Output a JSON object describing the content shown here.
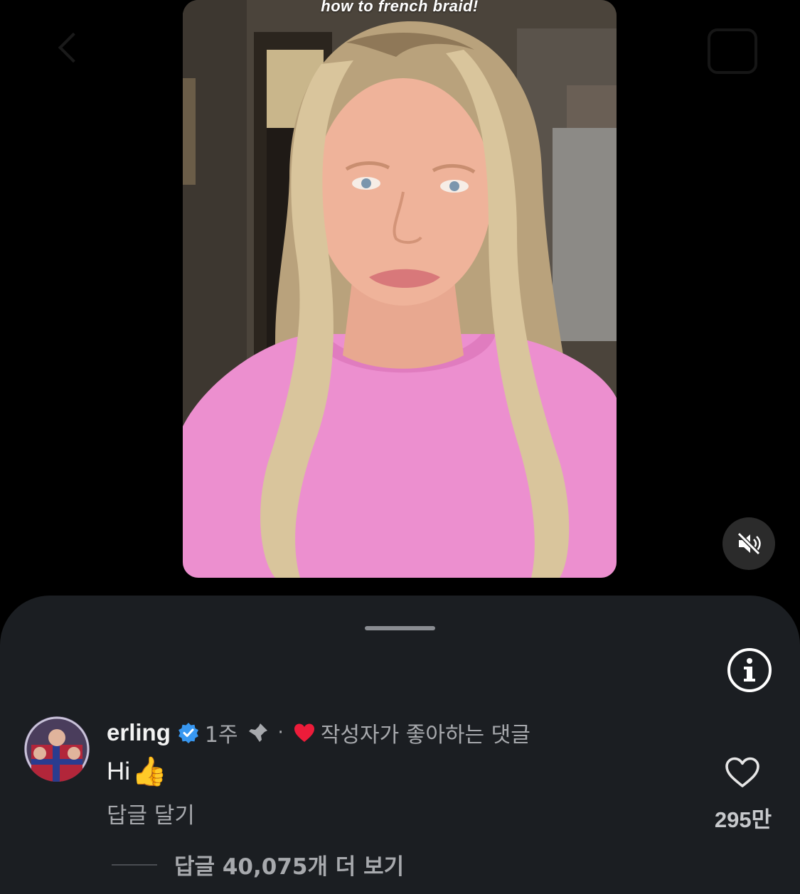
{
  "video": {
    "caption": "how to french braid!",
    "mute_icon": "speaker-muted-icon"
  },
  "sheet": {
    "info_icon": "info-icon"
  },
  "comment": {
    "username": "erling",
    "verified_icon": "verified-badge-icon",
    "time": "1주",
    "pin_icon": "pin-icon",
    "separator": "·",
    "liked_by_author_icon": "heart-icon",
    "liked_by_author_text": "작성자가 좋아하는 댓글",
    "text": "Hi",
    "emoji": "👍",
    "reply_label": "답글 달기",
    "like_icon": "heart-outline-icon",
    "like_count": "295만",
    "view_replies_label": "답글 40,075개 더 보기"
  },
  "colors": {
    "background": "#000000",
    "sheet": "#1b1e22",
    "primary_text": "#f2f2f2",
    "secondary_text": "#a7a9ad",
    "verified_blue": "#3897f0",
    "heart_red": "#ed1c3a",
    "shirt_pink": "#ec8fcf"
  }
}
